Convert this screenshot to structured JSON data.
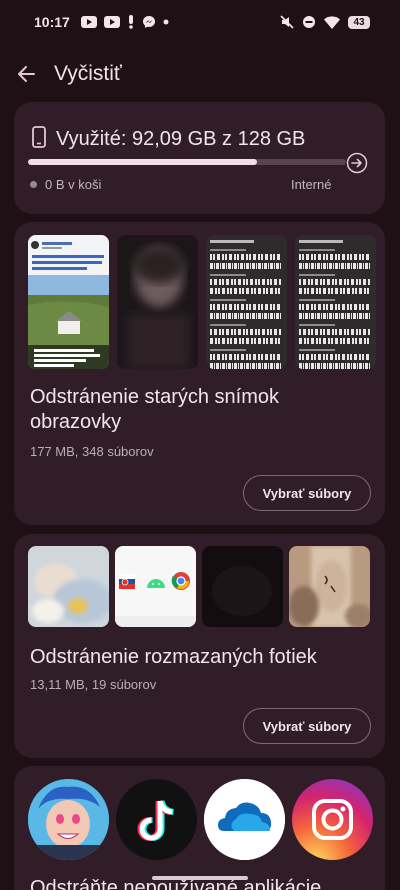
{
  "status_bar": {
    "time": "10:17",
    "battery": "43",
    "icons_left": [
      "youtube-icon",
      "youtube-icon",
      "alert-icon",
      "messenger-icon",
      "dot-icon"
    ],
    "icons_right": [
      "mute-icon",
      "dnd-icon",
      "wifi-icon",
      "battery-icon"
    ]
  },
  "top_bar": {
    "title": "Vyčistiť"
  },
  "storage": {
    "label": "Využité: 92,09 GB z 128 GB",
    "used_fraction": 0.72,
    "trash": "0 B v koši",
    "location": "Interné"
  },
  "screenshots_card": {
    "title": "Odstránenie starých snímok obrazovky",
    "subtitle": "177 MB, 348 súborov",
    "button": "Vybrať súbory"
  },
  "blurry_card": {
    "title": "Odstránenie rozmazaných fotiek",
    "subtitle": "13,11 MB, 19 súborov",
    "button": "Vybrať súbory"
  },
  "apps_card": {
    "title": "Odstráňte nepoužívané aplikácie",
    "apps": [
      "game-avatar-icon",
      "tiktok-icon",
      "onedrive-icon",
      "instagram-icon"
    ]
  },
  "colors": {
    "background": "#1f1016",
    "card": "#311d27",
    "accent": "#f2dde6"
  }
}
